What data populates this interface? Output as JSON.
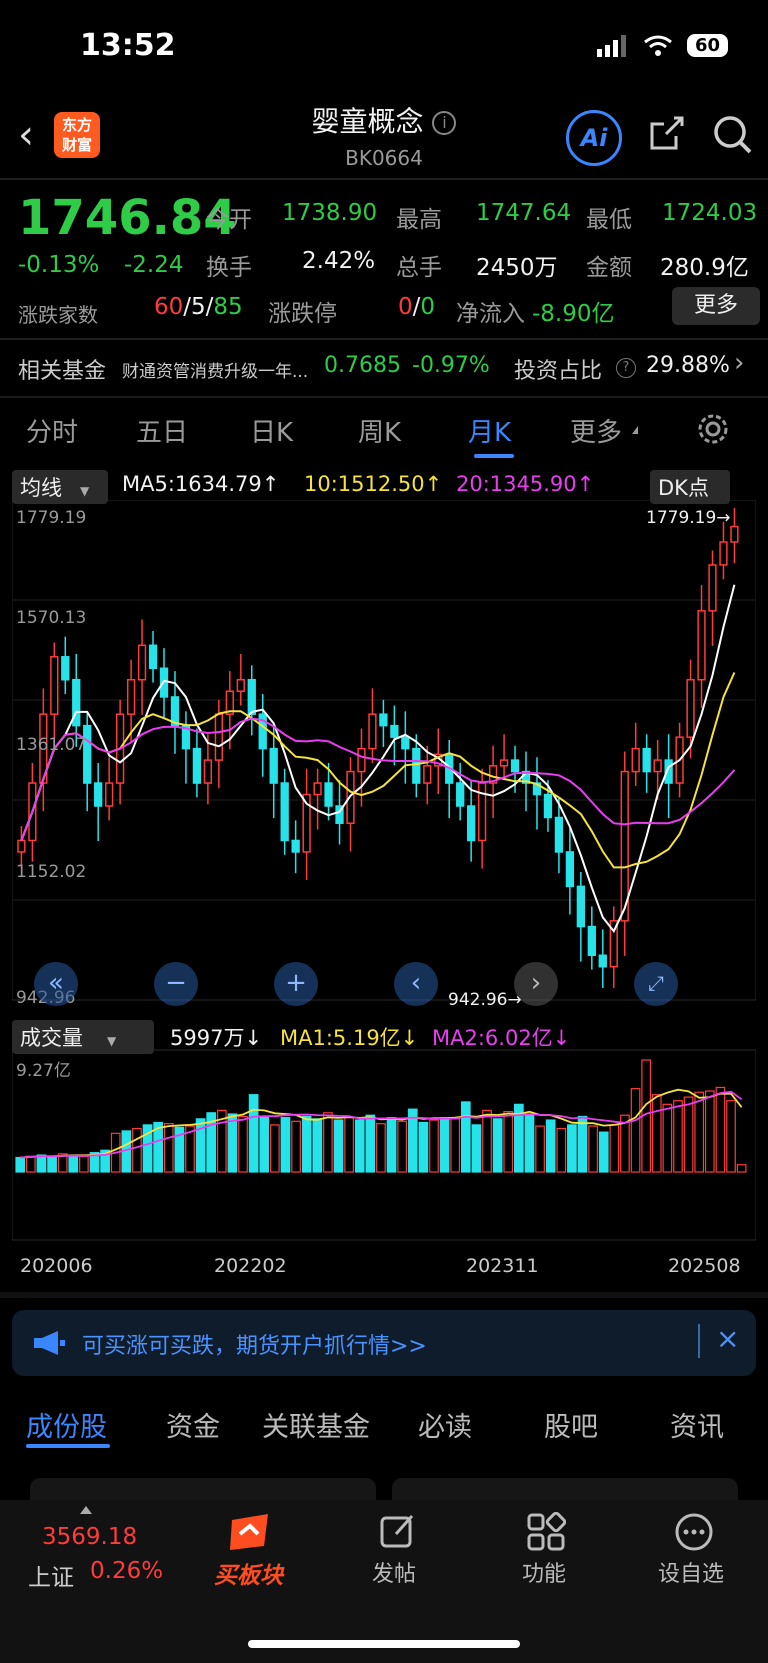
{
  "status": {
    "time": "13:52",
    "battery": "60"
  },
  "header": {
    "logo_line1": "东方",
    "logo_line2": "财富",
    "title": "婴童概念",
    "code": "BK0664",
    "ai_label": "Ai"
  },
  "quote": {
    "price": "1746.84",
    "change_pct": "-0.13%",
    "change": "-2.24",
    "open_label": "今开",
    "open": "1738.90",
    "high_label": "最高",
    "high": "1747.64",
    "low_label": "最低",
    "low": "1724.03",
    "turnover_label": "换手",
    "turnover": "2.42%",
    "volume_label": "总手",
    "volume": "2450万",
    "amount_label": "金额",
    "amount": "280.9亿",
    "breadth_label": "涨跌家数",
    "up": "60",
    "flat": "5",
    "down": "85",
    "limit_label": "涨跌停",
    "limit_up": "0",
    "limit_down": "0",
    "netflow_label": "净流入",
    "netflow": "-8.90亿",
    "more": "更多"
  },
  "fund": {
    "label": "相关基金",
    "name": "财通资管消费升级一年...",
    "nav": "0.7685",
    "pct": "-0.97%",
    "ratio_label": "投资占比",
    "ratio": "29.88%"
  },
  "ktabs": [
    "分时",
    "五日",
    "日K",
    "周K",
    "月K",
    "更多"
  ],
  "chart_header": {
    "ma_select": "均线",
    "ma5": "MA5:1634.79↑",
    "ma10": "10:1512.50↑",
    "ma20": "20:1345.90↑",
    "dk": "DK点"
  },
  "chart_axis": {
    "y": [
      "1779.19",
      "1570.13",
      "1361.07",
      "1152.02",
      "942.96"
    ],
    "high_mark": "1779.19→",
    "low_mark": "942.96→"
  },
  "vol_header": {
    "select": "成交量",
    "vol": "5997万↓",
    "ma1": "MA1:5.19亿↓",
    "ma2": "MA2:6.02亿↓",
    "ymax": "9.27亿"
  },
  "x_labels": [
    "202006",
    "202202",
    "202311",
    "202508"
  ],
  "colors": {
    "up": "#ff3b3b",
    "down": "#26e3ea",
    "ma5": "#ffffff",
    "ma10": "#f5e23b",
    "ma20": "#e83ef0",
    "accent": "#3a86ff"
  },
  "chart_data": [
    {
      "type": "candlestick",
      "title": "",
      "x": [
        "202006",
        "202202",
        "202311",
        "202508"
      ],
      "ylim": [
        942.96,
        1779.19
      ],
      "series_note": "monthly K with MA5/MA10/MA20",
      "closes": [
        1200,
        1300,
        1420,
        1520,
        1480,
        1400,
        1300,
        1260,
        1300,
        1420,
        1480,
        1540,
        1500,
        1450,
        1400,
        1360,
        1300,
        1340,
        1420,
        1460,
        1480,
        1420,
        1360,
        1300,
        1200,
        1180,
        1280,
        1300,
        1260,
        1230,
        1320,
        1360,
        1420,
        1400,
        1380,
        1360,
        1300,
        1330,
        1350,
        1300,
        1260,
        1200,
        1300,
        1330,
        1340,
        1320,
        1300,
        1280,
        1240,
        1180,
        1120,
        1050,
        1000,
        980,
        1060,
        1320,
        1360,
        1320,
        1340,
        1300,
        1380,
        1480,
        1600,
        1680,
        1720,
        1746.84
      ]
    },
    {
      "type": "bar",
      "title": "",
      "ylim": [
        0,
        9.27
      ],
      "values": [
        1.2,
        1.3,
        1.4,
        1.3,
        1.5,
        1.4,
        1.3,
        1.6,
        1.8,
        3.2,
        3.4,
        3.6,
        3.9,
        4.1,
        4.0,
        3.7,
        3.8,
        4.4,
        4.9,
        5.1,
        4.8,
        4.6,
        6.4,
        4.6,
        3.9,
        4.5,
        4.2,
        4.6,
        4.4,
        4.9,
        4.3,
        4.5,
        4.3,
        4.7,
        4.0,
        4.5,
        4.2,
        5.2,
        4.1,
        4.3,
        4.5,
        4.4,
        5.8,
        3.9,
        5.1,
        4.4,
        5.0,
        5.6,
        4.8,
        3.8,
        4.3,
        3.6,
        3.9,
        4.6,
        3.8,
        3.3,
        3.9,
        4.7,
        6.9,
        9.27,
        6.4,
        5.6,
        5.9,
        6.2,
        6.6,
        6.7,
        7.0,
        5.9,
        0.6
      ]
    }
  ],
  "banner": {
    "text": "可买涨可买跌，期货开户抓行情>>"
  },
  "stabs": [
    "成份股",
    "资金",
    "关联基金",
    "必读",
    "股吧",
    "资讯"
  ],
  "bottom": {
    "index_value": "3569.18",
    "index_name": "上证",
    "index_pct": "0.26%",
    "buy_block": "买板块",
    "post": "发帖",
    "func": "功能",
    "watch": "设自选"
  }
}
